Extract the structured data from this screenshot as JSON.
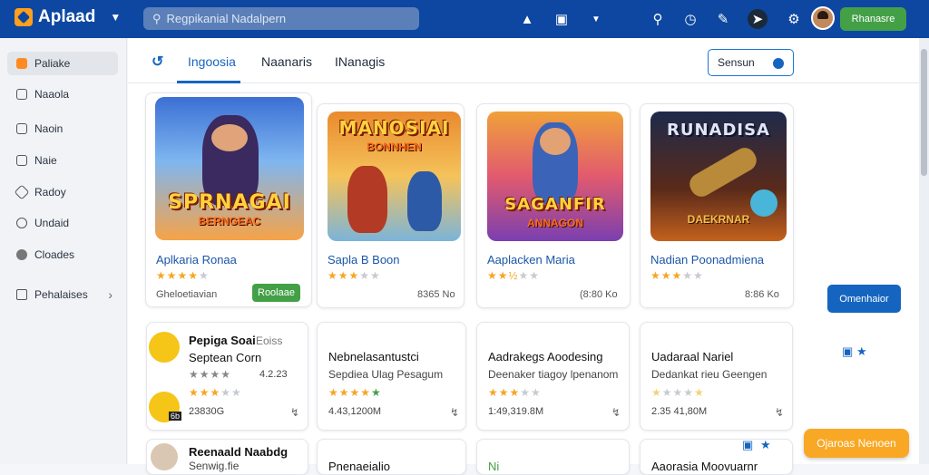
{
  "app": {
    "name": "Aplaad"
  },
  "search": {
    "placeholder": "Regpikanial Nadalpern"
  },
  "header": {
    "action_label": "Rhanasre"
  },
  "sidebar": {
    "items": [
      {
        "label": "Paliake",
        "icon": "app-icon"
      },
      {
        "label": "Naaola",
        "icon": "home-icon"
      },
      {
        "label": "Naoin",
        "icon": "grid-icon"
      },
      {
        "label": "Naie",
        "icon": "card-icon"
      },
      {
        "label": "Radoy",
        "icon": "tag-icon"
      },
      {
        "label": "Undaid",
        "icon": "lock-icon"
      },
      {
        "label": "Cloades",
        "icon": "cloud-icon"
      },
      {
        "label": "Pehalaises",
        "icon": "puzzle-icon"
      }
    ]
  },
  "tabs": [
    {
      "label": "Ingoosia"
    },
    {
      "label": "Naanaris"
    },
    {
      "label": "INanagis"
    }
  ],
  "sort": {
    "label": "Sensun"
  },
  "featured": [
    {
      "art_title": "SPRNAGAI",
      "art_sub": "BERNGEAC",
      "title": "Aplkaria Ronaa",
      "stars": 4,
      "meta": "Gheloetiavian",
      "price": "Roolaae"
    },
    {
      "art_title": "MANOSIAI",
      "art_sub": "BONNHEN",
      "title": "Sapla B Boon",
      "stars": 3,
      "meta": "8365 No",
      "price": ""
    },
    {
      "art_title": "SAGANFIR",
      "art_sub": "ANNAGON",
      "title": "Aaplacken Maria",
      "stars": 2.5,
      "meta": "(8:80 Ko",
      "price": ""
    },
    {
      "art_title": "RUNADISA",
      "art_sub": "DAEKRNAR",
      "title": "Nadian Poonadmiena",
      "stars": 3,
      "meta": "8:86 Ko",
      "price": ""
    }
  ],
  "right_panel": {
    "cta_label": "Omenhaior"
  },
  "list": [
    {
      "title": "Pepiga Soai",
      "title_suffix": "Eoiss",
      "subtitle": "Septean Corn",
      "sub_meta": "4.2.23",
      "stars": 3,
      "size": "23830G",
      "badge": "6b"
    },
    {
      "title": "Nebnelasantustci",
      "subtitle": "Sepdiea Ulag Pesagum",
      "stars": 4.5,
      "size": "4.43,1200M"
    },
    {
      "title": "Aadrakegs Aoodesing",
      "subtitle": "Deenaker tiagoy lpenanom",
      "stars": 3,
      "size": "1:49,319.8M"
    },
    {
      "title": "Uadaraal Nariel",
      "subtitle": "Dedankat rieu Geengen",
      "stars": 2,
      "size": "2.35 41,80M"
    }
  ],
  "list_row3": [
    {
      "title": "Reenaald Naabdg",
      "subtitle": "Senwig.fie"
    },
    {
      "title": "Pnenaeialio"
    },
    {
      "title": "Ni"
    },
    {
      "title": "Aaorasia Moovuarnr"
    }
  ],
  "float_button": {
    "label": "Ojaroas Nenoen"
  },
  "colors": {
    "topbar": "#0d47a1",
    "accent": "#1565c0",
    "green": "#43a047",
    "orange": "#f9a825",
    "star": "#f5a623"
  }
}
